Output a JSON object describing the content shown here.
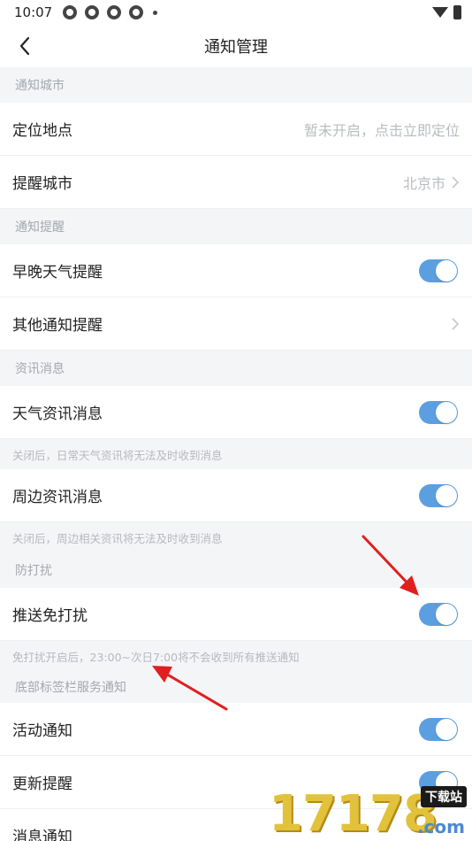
{
  "status_bar": {
    "time": "10:07"
  },
  "header": {
    "title": "通知管理"
  },
  "sections": {
    "city": {
      "title": "通知城市",
      "location": {
        "label": "定位地点",
        "value": "暂未开启，点击立即定位"
      },
      "remind_city": {
        "label": "提醒城市",
        "value": "北京市"
      }
    },
    "remind": {
      "title": "通知提醒",
      "morning_evening": {
        "label": "早晚天气提醒",
        "enabled": true
      },
      "other": {
        "label": "其他通知提醒"
      }
    },
    "news": {
      "title": "资讯消息",
      "weather_news": {
        "label": "天气资讯消息",
        "enabled": true,
        "hint": "关闭后，日常天气资讯将无法及时收到消息"
      },
      "nearby_news": {
        "label": "周边资讯消息",
        "enabled": true,
        "hint": "关闭后，周边相关资讯将无法及时收到消息"
      }
    },
    "dnd": {
      "title": "防打扰",
      "push_dnd": {
        "label": "推送免打扰",
        "enabled": true,
        "hint": "免打扰开启后，23:00~次日7:00将不会收到所有推送通知"
      }
    },
    "bottom_tab": {
      "title": "底部标签栏服务通知",
      "activity": {
        "label": "活动通知",
        "enabled": true
      },
      "update": {
        "label": "更新提醒",
        "enabled": true
      },
      "message": {
        "label": "消息通知"
      }
    }
  },
  "watermark": {
    "digits": "17178",
    "badge": "下载站",
    "suffix": ".com"
  },
  "colors": {
    "toggle_on": "#5c9fe0",
    "annotation_arrow": "#e02020"
  }
}
